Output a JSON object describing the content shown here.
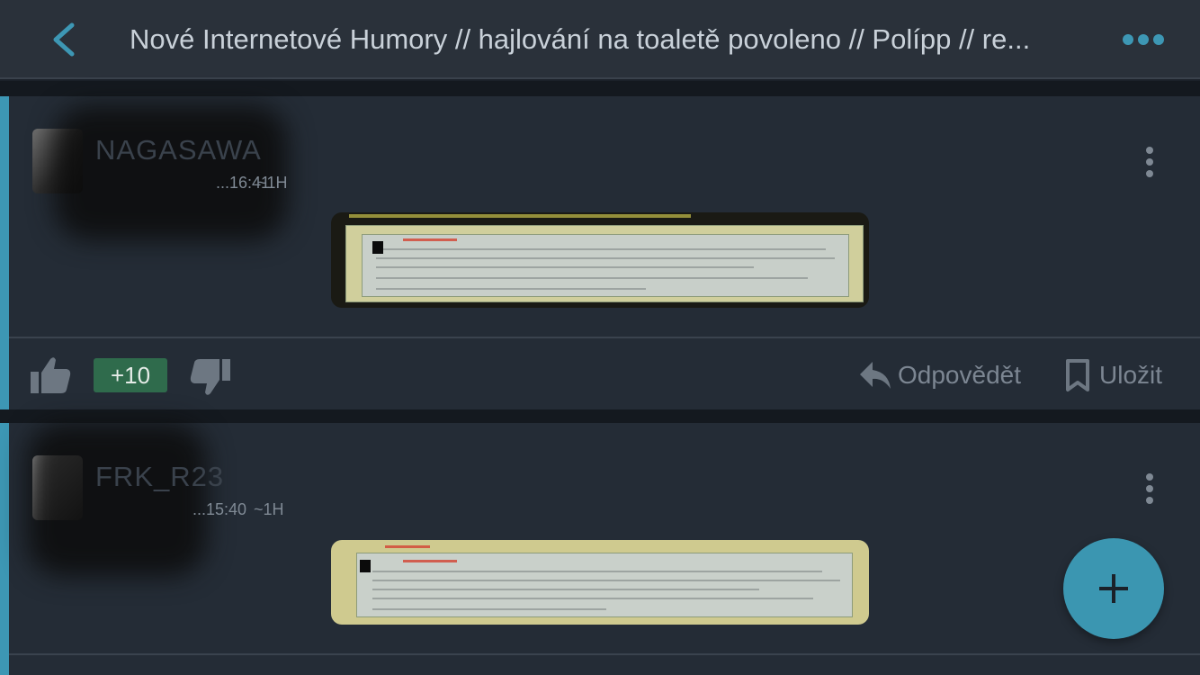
{
  "header": {
    "title": "Nové Internetové Humory // hajlování na toaletě povoleno  // Polípp // re..."
  },
  "posts": [
    {
      "username": "NAGASAWA",
      "timestamp": "...16:41",
      "relative_time": "~1H",
      "score": "+10",
      "reply_label": "Odpovědět",
      "save_label": "Uložit"
    },
    {
      "username": "FRK_R23",
      "timestamp": "...15:40",
      "relative_time": "~1H"
    }
  ],
  "colors": {
    "accent": "#3d97b4",
    "score_bg": "#2f6b4c",
    "fab": "#3b96b1"
  },
  "icons": {
    "back": "chevron-left-icon",
    "more": "more-horizontal-icon",
    "post_menu": "more-vertical-icon",
    "like": "thumbs-up-icon",
    "dislike": "thumbs-down-icon",
    "reply": "reply-icon",
    "save": "bookmark-icon",
    "fab": "plus-icon"
  }
}
